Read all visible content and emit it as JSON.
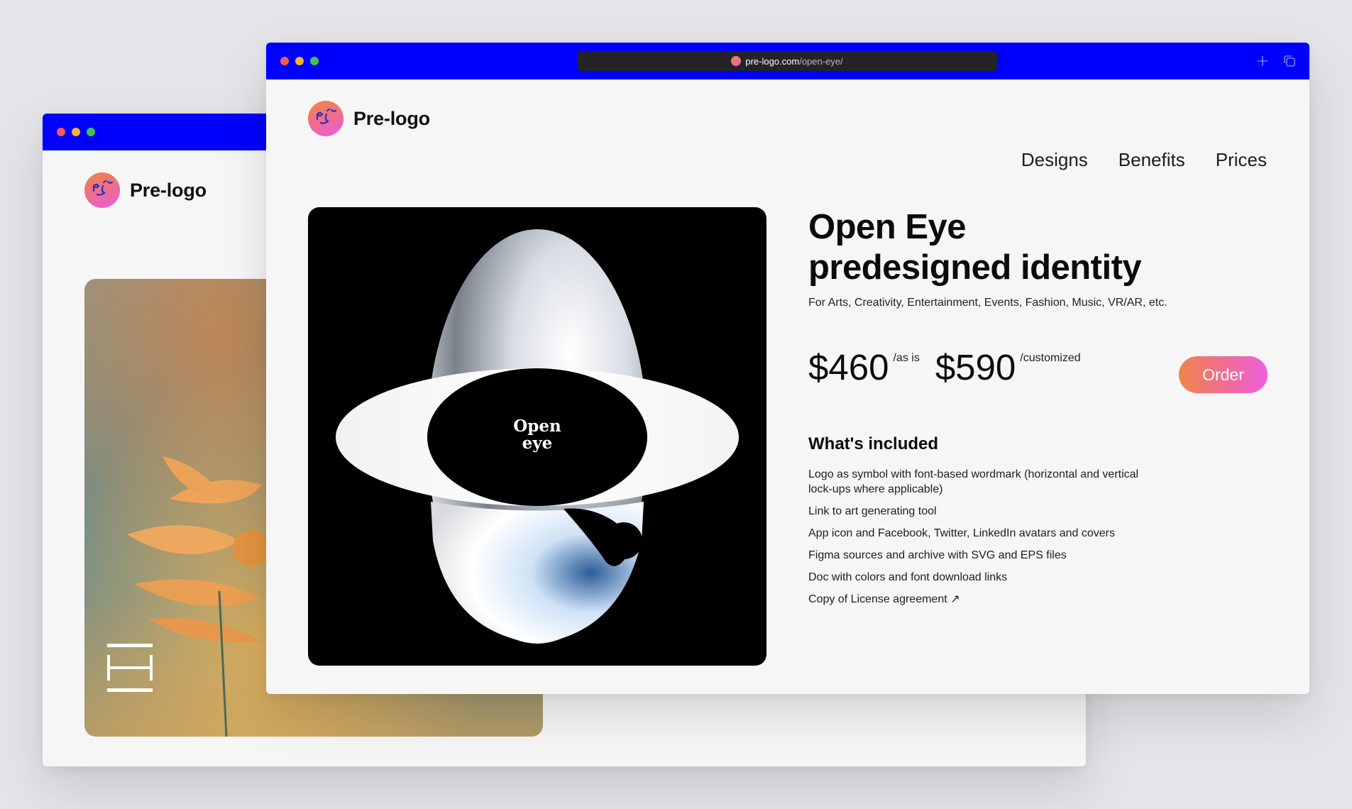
{
  "colors": {
    "titlebar": "#0000fe",
    "accent_gradient_start": "#f0834a",
    "accent_gradient_end": "#ec5fe0",
    "traffic_close": "#f45a55",
    "traffic_min": "#f5b32d",
    "traffic_max": "#3ec74f"
  },
  "back_window": {
    "brand": {
      "name": "Pre-logo"
    },
    "photo_glyph": "H"
  },
  "front_window": {
    "url": {
      "host": "pre-logo.com",
      "path": "/open-eye/"
    },
    "titlebar_icons": [
      "plus-icon",
      "duplicate-icon"
    ],
    "brand": {
      "name": "Pre-logo"
    },
    "nav": [
      "Designs",
      "Benefits",
      "Prices"
    ],
    "product": {
      "artwork_text": [
        "Open",
        "eye"
      ],
      "title_lines": [
        "Open Eye",
        "predesigned identity"
      ],
      "subtitle": "For Arts, Creativity, Entertainment, Events, Fashion, Music, VR/AR, etc.",
      "prices": [
        {
          "amount": "$460",
          "note": "/as is"
        },
        {
          "amount": "$590",
          "note": "/customized"
        }
      ],
      "order_label": "Order",
      "included_title": "What's included",
      "included": [
        "Logo as symbol with font-based wordmark (horizontal and vertical lock-ups where applicable)",
        "Link to art generating tool",
        "App icon and Facebook, Twitter, LinkedIn avatars and covers",
        "Figma sources and archive with SVG and EPS files",
        "Doc with colors and font download links",
        "Copy of License agreement ↗"
      ]
    }
  }
}
